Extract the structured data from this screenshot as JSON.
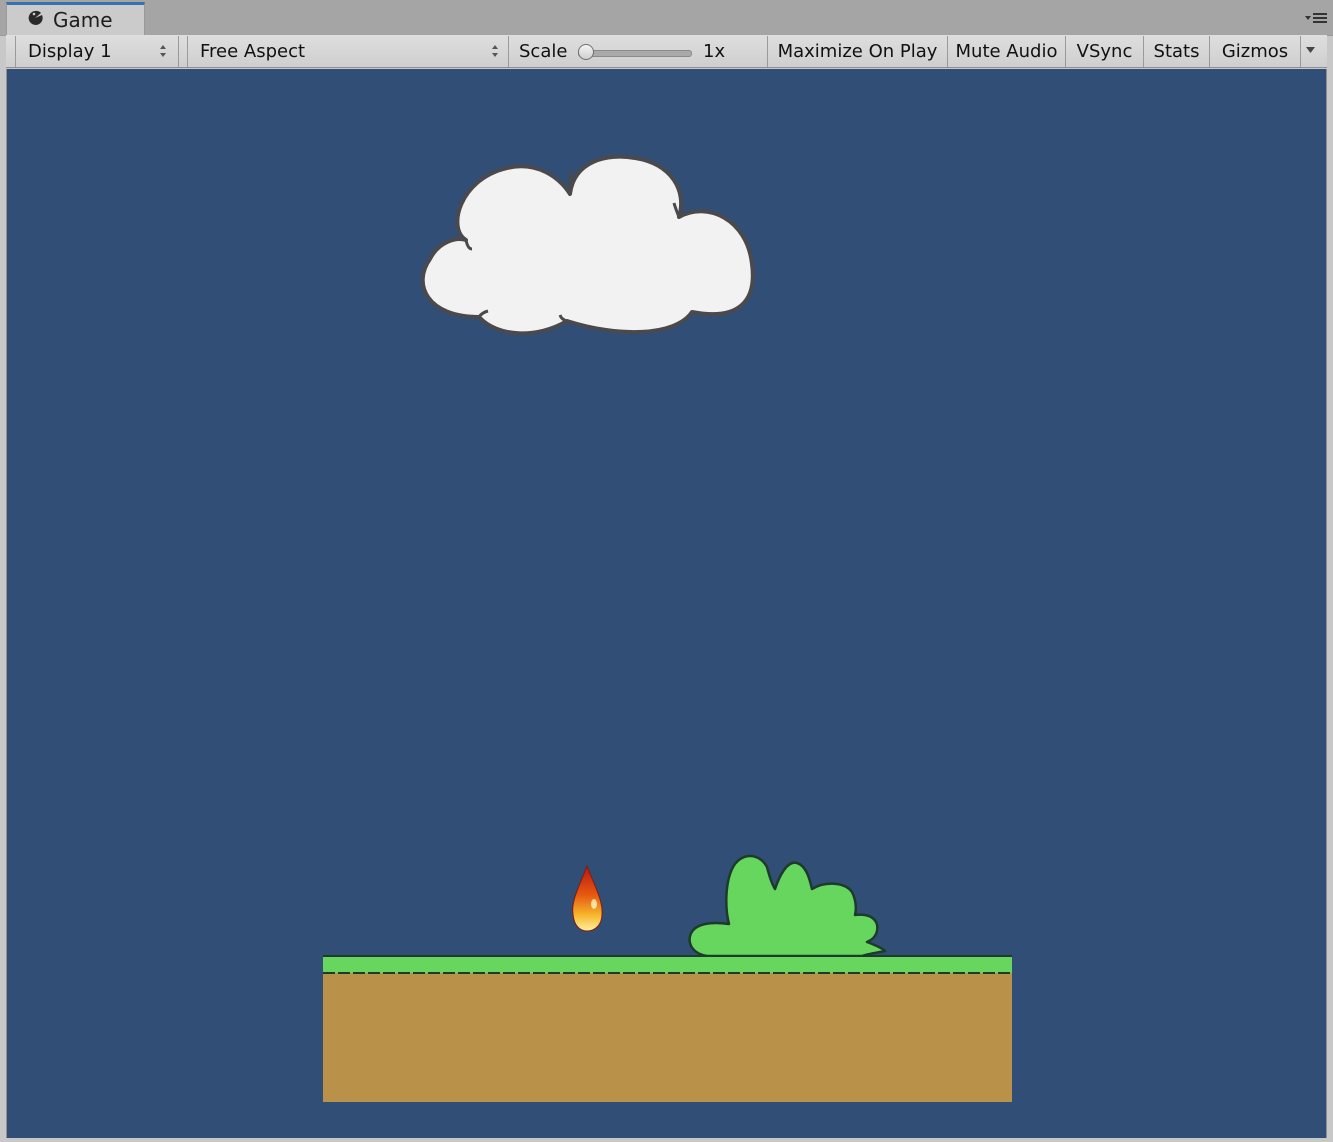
{
  "tab": {
    "title": "Game",
    "icon": "pacman-game-icon"
  },
  "toolbar": {
    "display_value": "Display 1",
    "aspect_value": "Free Aspect",
    "scale_label": "Scale",
    "scale_value": "1x",
    "scale_level": 1,
    "maximize_label": "Maximize On Play",
    "mute_label": "Mute Audio",
    "vsync_label": "VSync",
    "stats_label": "Stats",
    "gizmos_label": "Gizmos"
  },
  "colors": {
    "sky": "#314e77",
    "cloud": "#f2f2f2",
    "grass": "#66d65e",
    "dirt": "#b99149",
    "tab_accent": "#3a72b0"
  },
  "scene": {
    "objects": [
      "cloud",
      "flame",
      "bush",
      "ground-platform"
    ]
  }
}
